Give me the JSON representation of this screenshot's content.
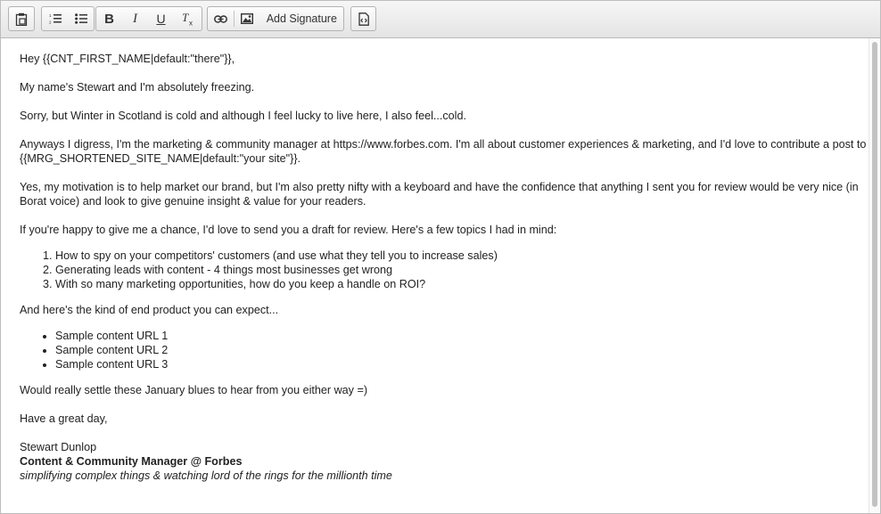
{
  "toolbar": {
    "add_signature_label": "Add Signature"
  },
  "content": {
    "greeting": "Hey {{CNT_FIRST_NAME|default:\"there\"}},",
    "p1": "My name's Stewart and I'm absolutely freezing.",
    "p2": "Sorry, but Winter in Scotland is cold and although I feel lucky to live here, I also feel...cold.",
    "p3": "Anyways I digress, I'm the marketing & community manager at https://www.forbes.com. I'm all about customer experiences & marketing, and I'd love to contribute a post to {{MRG_SHORTENED_SITE_NAME|default:\"your site\"}}.",
    "p4": "Yes, my motivation is to help market our brand, but I'm also pretty nifty with a keyboard and have the confidence that anything I sent you for review would be very nice (in Borat voice) and look to give genuine insight & value for your readers.",
    "p5": "If you're happy to give me a chance, I'd love to send you a draft for review. Here's a few topics I had in mind:",
    "topics": [
      "How to spy on your competitors' customers (and use what they tell you to increase sales)",
      "Generating leads with content - 4 things most businesses get wrong",
      "With so many marketing opportunities, how do you keep a handle on ROI?"
    ],
    "p6": "And here's the kind of end product you can expect...",
    "samples": [
      "Sample content URL 1",
      "Sample content URL 2",
      "Sample content URL 3"
    ],
    "p7": "Would really settle these January blues to hear from you either way =)",
    "p8": "Have a great day,",
    "sig_name": "Stewart Dunlop",
    "sig_title": "Content & Community Manager @ Forbes",
    "sig_tagline": "simplifying complex things & watching lord of the rings for the millionth time"
  }
}
